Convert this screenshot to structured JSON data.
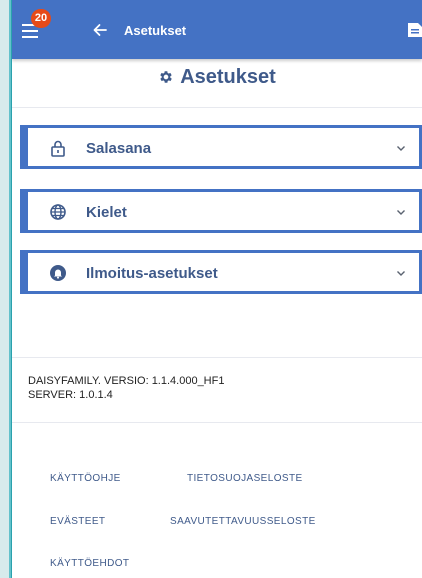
{
  "appbar": {
    "notification_count": "20",
    "title": "Asetukset"
  },
  "page": {
    "title": "Asetukset"
  },
  "sections": [
    {
      "label": "Salasana",
      "icon": "lock-icon"
    },
    {
      "label": "Kielet",
      "icon": "globe-icon"
    },
    {
      "label": "Ilmoitus-asetukset",
      "icon": "bell-icon"
    }
  ],
  "version": {
    "app": "DAISYFAMILY. VERSIO: 1.1.4.000_HF1",
    "server": "SERVER: 1.0.1.4"
  },
  "links": {
    "manual": "KÄYTTÖOHJE",
    "privacy": "TIETOSUOJASELOSTE",
    "cookies": "EVÄSTEET",
    "accessibility": "SAAVUTETTAVUUSSELOSTE",
    "terms": "KÄYTTÖEHDOT"
  },
  "colors": {
    "accent": "#4472c4",
    "badge": "#e64a19",
    "text": "#3f5a8a",
    "background": "#d7ebec"
  }
}
